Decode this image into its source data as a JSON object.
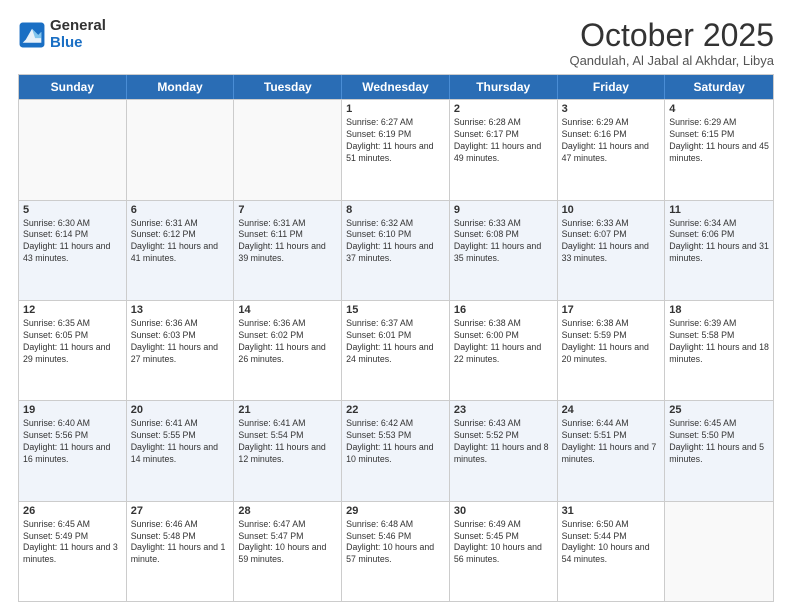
{
  "logo": {
    "general": "General",
    "blue": "Blue"
  },
  "header": {
    "month": "October 2025",
    "location": "Qandulah, Al Jabal al Akhdar, Libya"
  },
  "days_of_week": [
    "Sunday",
    "Monday",
    "Tuesday",
    "Wednesday",
    "Thursday",
    "Friday",
    "Saturday"
  ],
  "weeks": [
    [
      {
        "day": "",
        "info": ""
      },
      {
        "day": "",
        "info": ""
      },
      {
        "day": "",
        "info": ""
      },
      {
        "day": "1",
        "info": "Sunrise: 6:27 AM\nSunset: 6:19 PM\nDaylight: 11 hours and 51 minutes."
      },
      {
        "day": "2",
        "info": "Sunrise: 6:28 AM\nSunset: 6:17 PM\nDaylight: 11 hours and 49 minutes."
      },
      {
        "day": "3",
        "info": "Sunrise: 6:29 AM\nSunset: 6:16 PM\nDaylight: 11 hours and 47 minutes."
      },
      {
        "day": "4",
        "info": "Sunrise: 6:29 AM\nSunset: 6:15 PM\nDaylight: 11 hours and 45 minutes."
      }
    ],
    [
      {
        "day": "5",
        "info": "Sunrise: 6:30 AM\nSunset: 6:14 PM\nDaylight: 11 hours and 43 minutes."
      },
      {
        "day": "6",
        "info": "Sunrise: 6:31 AM\nSunset: 6:12 PM\nDaylight: 11 hours and 41 minutes."
      },
      {
        "day": "7",
        "info": "Sunrise: 6:31 AM\nSunset: 6:11 PM\nDaylight: 11 hours and 39 minutes."
      },
      {
        "day": "8",
        "info": "Sunrise: 6:32 AM\nSunset: 6:10 PM\nDaylight: 11 hours and 37 minutes."
      },
      {
        "day": "9",
        "info": "Sunrise: 6:33 AM\nSunset: 6:08 PM\nDaylight: 11 hours and 35 minutes."
      },
      {
        "day": "10",
        "info": "Sunrise: 6:33 AM\nSunset: 6:07 PM\nDaylight: 11 hours and 33 minutes."
      },
      {
        "day": "11",
        "info": "Sunrise: 6:34 AM\nSunset: 6:06 PM\nDaylight: 11 hours and 31 minutes."
      }
    ],
    [
      {
        "day": "12",
        "info": "Sunrise: 6:35 AM\nSunset: 6:05 PM\nDaylight: 11 hours and 29 minutes."
      },
      {
        "day": "13",
        "info": "Sunrise: 6:36 AM\nSunset: 6:03 PM\nDaylight: 11 hours and 27 minutes."
      },
      {
        "day": "14",
        "info": "Sunrise: 6:36 AM\nSunset: 6:02 PM\nDaylight: 11 hours and 26 minutes."
      },
      {
        "day": "15",
        "info": "Sunrise: 6:37 AM\nSunset: 6:01 PM\nDaylight: 11 hours and 24 minutes."
      },
      {
        "day": "16",
        "info": "Sunrise: 6:38 AM\nSunset: 6:00 PM\nDaylight: 11 hours and 22 minutes."
      },
      {
        "day": "17",
        "info": "Sunrise: 6:38 AM\nSunset: 5:59 PM\nDaylight: 11 hours and 20 minutes."
      },
      {
        "day": "18",
        "info": "Sunrise: 6:39 AM\nSunset: 5:58 PM\nDaylight: 11 hours and 18 minutes."
      }
    ],
    [
      {
        "day": "19",
        "info": "Sunrise: 6:40 AM\nSunset: 5:56 PM\nDaylight: 11 hours and 16 minutes."
      },
      {
        "day": "20",
        "info": "Sunrise: 6:41 AM\nSunset: 5:55 PM\nDaylight: 11 hours and 14 minutes."
      },
      {
        "day": "21",
        "info": "Sunrise: 6:41 AM\nSunset: 5:54 PM\nDaylight: 11 hours and 12 minutes."
      },
      {
        "day": "22",
        "info": "Sunrise: 6:42 AM\nSunset: 5:53 PM\nDaylight: 11 hours and 10 minutes."
      },
      {
        "day": "23",
        "info": "Sunrise: 6:43 AM\nSunset: 5:52 PM\nDaylight: 11 hours and 8 minutes."
      },
      {
        "day": "24",
        "info": "Sunrise: 6:44 AM\nSunset: 5:51 PM\nDaylight: 11 hours and 7 minutes."
      },
      {
        "day": "25",
        "info": "Sunrise: 6:45 AM\nSunset: 5:50 PM\nDaylight: 11 hours and 5 minutes."
      }
    ],
    [
      {
        "day": "26",
        "info": "Sunrise: 6:45 AM\nSunset: 5:49 PM\nDaylight: 11 hours and 3 minutes."
      },
      {
        "day": "27",
        "info": "Sunrise: 6:46 AM\nSunset: 5:48 PM\nDaylight: 11 hours and 1 minute."
      },
      {
        "day": "28",
        "info": "Sunrise: 6:47 AM\nSunset: 5:47 PM\nDaylight: 10 hours and 59 minutes."
      },
      {
        "day": "29",
        "info": "Sunrise: 6:48 AM\nSunset: 5:46 PM\nDaylight: 10 hours and 57 minutes."
      },
      {
        "day": "30",
        "info": "Sunrise: 6:49 AM\nSunset: 5:45 PM\nDaylight: 10 hours and 56 minutes."
      },
      {
        "day": "31",
        "info": "Sunrise: 6:50 AM\nSunset: 5:44 PM\nDaylight: 10 hours and 54 minutes."
      },
      {
        "day": "",
        "info": ""
      }
    ]
  ]
}
